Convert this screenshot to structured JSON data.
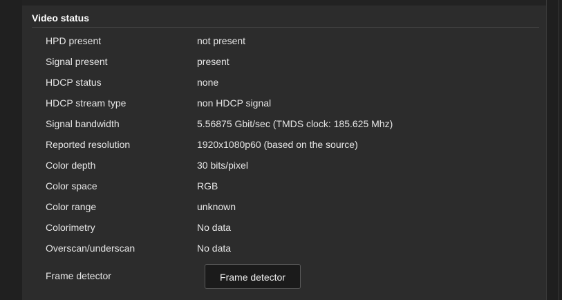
{
  "section": {
    "title": "Video status"
  },
  "rows": [
    {
      "label": "HPD present",
      "value": "not present"
    },
    {
      "label": "Signal present",
      "value": "present"
    },
    {
      "label": "HDCP status",
      "value": "none"
    },
    {
      "label": "HDCP stream type",
      "value": "non HDCP signal"
    },
    {
      "label": "Signal bandwidth",
      "value": "5.56875 Gbit/sec (TMDS clock: 185.625 Mhz)"
    },
    {
      "label": "Reported resolution",
      "value": "1920x1080p60 (based on the source)"
    },
    {
      "label": "Color depth",
      "value": "30 bits/pixel"
    },
    {
      "label": "Color space",
      "value": "RGB"
    },
    {
      "label": "Color range",
      "value": "unknown"
    },
    {
      "label": "Colorimetry",
      "value": "No data"
    },
    {
      "label": "Overscan/underscan",
      "value": "No data"
    }
  ],
  "frame_detector": {
    "label": "Frame detector",
    "button_label": "Frame detector"
  },
  "colors": {
    "background": "#222222",
    "panel": "#2c2c2c",
    "text": "#e6e6e6",
    "button_bg": "#1b1b1b"
  }
}
